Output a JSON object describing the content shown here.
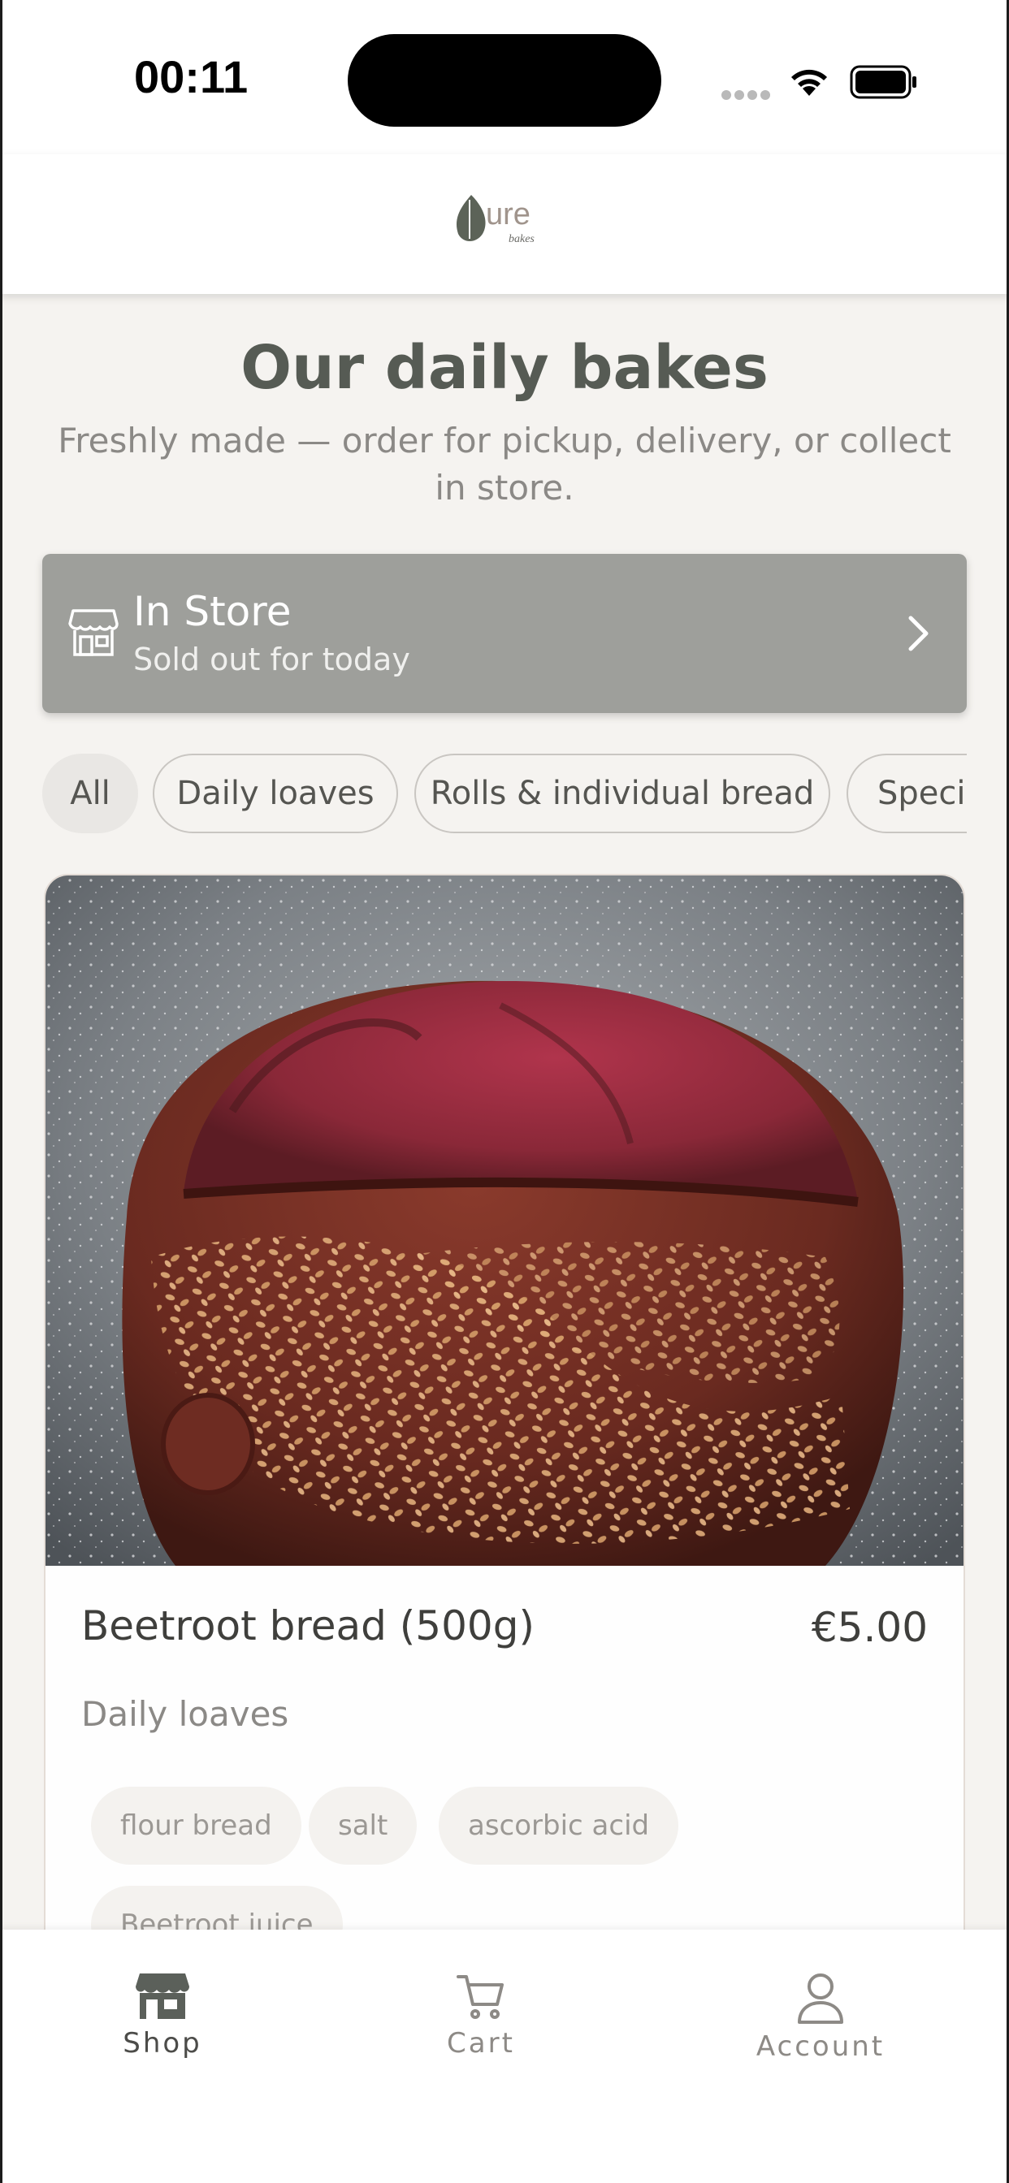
{
  "status_bar": {
    "time": "00:11"
  },
  "header": {
    "logo_name": "pure-bakes-logo",
    "logo_text": "ure",
    "logo_subtext": "bakes"
  },
  "hero": {
    "title": "Our daily bakes",
    "subtitle": "Freshly made — order for pickup, delivery, or collect in store."
  },
  "store_banner": {
    "title": "In Store",
    "status": "Sold out for today",
    "icon": "store-icon"
  },
  "categories": [
    {
      "label": "All",
      "active": true
    },
    {
      "label": "Daily loaves",
      "active": false
    },
    {
      "label": "Rolls & individual bread",
      "active": false
    },
    {
      "label": "Specia",
      "active": false
    }
  ],
  "product": {
    "name": "Beetroot bread (500g)",
    "price": "€5.00",
    "category": "Daily loaves",
    "ingredients": [
      "flour bread",
      "salt",
      "ascorbic acid",
      "Beetroot juice"
    ]
  },
  "tab_bar": {
    "tabs": [
      {
        "label": "Shop",
        "icon": "shop-icon",
        "active": true
      },
      {
        "label": "Cart",
        "icon": "cart-icon",
        "active": false
      },
      {
        "label": "Account",
        "icon": "account-icon",
        "active": false
      }
    ]
  },
  "colors": {
    "background": "#f5f3f0",
    "banner": "#9e9f9b",
    "title": "#565b54",
    "logo_leaf": "#5c6358"
  }
}
